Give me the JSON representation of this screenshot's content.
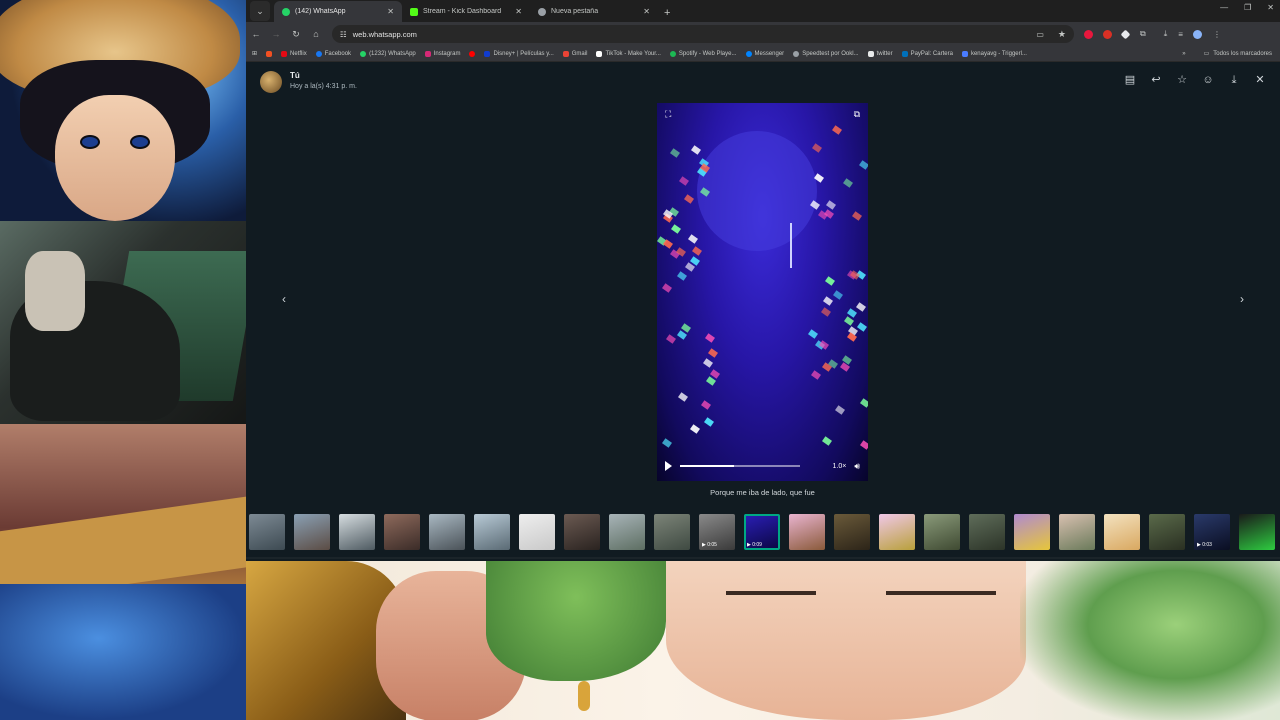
{
  "browser": {
    "tabs": [
      {
        "label": "(142) WhatsApp",
        "color": "#25d366",
        "active": true
      },
      {
        "label": "Stream - Kick Dashboard",
        "color": "#53fc18",
        "active": false
      },
      {
        "label": "Nueva pestaña",
        "color": "#9aa0a6",
        "active": false
      }
    ],
    "url": "web.whatsapp.com",
    "bookmarks": [
      {
        "label": "Netflix",
        "color": "#e50914"
      },
      {
        "label": "Facebook",
        "color": "#1877f2"
      },
      {
        "label": "(1232) WhatsApp",
        "color": "#25d366"
      },
      {
        "label": "Instagram",
        "color": "#d62976"
      },
      {
        "label": "",
        "color": "#ff0000"
      },
      {
        "label": "Disney+ | Películas y...",
        "color": "#113ccf"
      },
      {
        "label": "Gmail",
        "color": "#ea4335"
      },
      {
        "label": "TikTok - Make Your...",
        "color": "#ffffff"
      },
      {
        "label": "Spotify - Web Playe...",
        "color": "#1db954"
      },
      {
        "label": "Messenger",
        "color": "#0084ff"
      },
      {
        "label": "Speedtest por Ookl...",
        "color": "#9aa0a6"
      },
      {
        "label": "twitter",
        "color": "#e7e9ea"
      },
      {
        "label": "PayPal: Cartera",
        "color": "#0070ba"
      },
      {
        "label": "kenayavg - Triggerl...",
        "color": "#4a7cff"
      }
    ],
    "all_bookmarks": "Todos los marcadores"
  },
  "viewer": {
    "sender": "Tú",
    "timestamp": "Hoy a la(s) 4:31 p. m.",
    "caption": "Porque me iba de lado, que fue",
    "speed": "1.0×",
    "progress": 0.45
  },
  "thumbnails": [
    {
      "c1": "#7d8a94",
      "c2": "#3d4a52",
      "duration": ""
    },
    {
      "c1": "#8aa0b4",
      "c2": "#5b4c44",
      "duration": ""
    },
    {
      "c1": "#d6dde0",
      "c2": "#4e5a61",
      "duration": ""
    },
    {
      "c1": "#8e6a5c",
      "c2": "#3b2c28",
      "duration": ""
    },
    {
      "c1": "#a9b8c2",
      "c2": "#4a5258",
      "duration": ""
    },
    {
      "c1": "#b8cad6",
      "c2": "#5a6a74",
      "duration": ""
    },
    {
      "c1": "#eeeeee",
      "c2": "#c9c9c9",
      "duration": ""
    },
    {
      "c1": "#6b5a52",
      "c2": "#2a2320",
      "duration": ""
    },
    {
      "c1": "#a8b4b8",
      "c2": "#5d6e62",
      "duration": ""
    },
    {
      "c1": "#7c8478",
      "c2": "#3f4a42",
      "duration": ""
    },
    {
      "c1": "#8a8a8a",
      "c2": "#3a3a3a",
      "duration": "0:05"
    },
    {
      "c1": "#2b1fb8",
      "c2": "#0a0640",
      "duration": "0:09",
      "selected": true
    },
    {
      "c1": "#e9b4d0",
      "c2": "#8a5a3a",
      "duration": ""
    },
    {
      "c1": "#6a5a3a",
      "c2": "#2c2418",
      "duration": ""
    },
    {
      "c1": "#f0c8e8",
      "c2": "#b8a03a",
      "duration": ""
    },
    {
      "c1": "#8a9a7a",
      "c2": "#3f4a32",
      "duration": ""
    },
    {
      "c1": "#5f6d5a",
      "c2": "#2c3428",
      "duration": ""
    },
    {
      "c1": "#b08ad0",
      "c2": "#e6c63a",
      "duration": ""
    },
    {
      "c1": "#d8c0b0",
      "c2": "#6a7a5a",
      "duration": ""
    },
    {
      "c1": "#f3e2c0",
      "c2": "#d9a860",
      "duration": ""
    },
    {
      "c1": "#5a6a4a",
      "c2": "#2a3022",
      "duration": ""
    },
    {
      "c1": "#2a3a6a",
      "c2": "#0a0e22",
      "duration": "0:03"
    },
    {
      "c1": "#1a1a1a",
      "c2": "#2ecc40",
      "duration": ""
    }
  ]
}
